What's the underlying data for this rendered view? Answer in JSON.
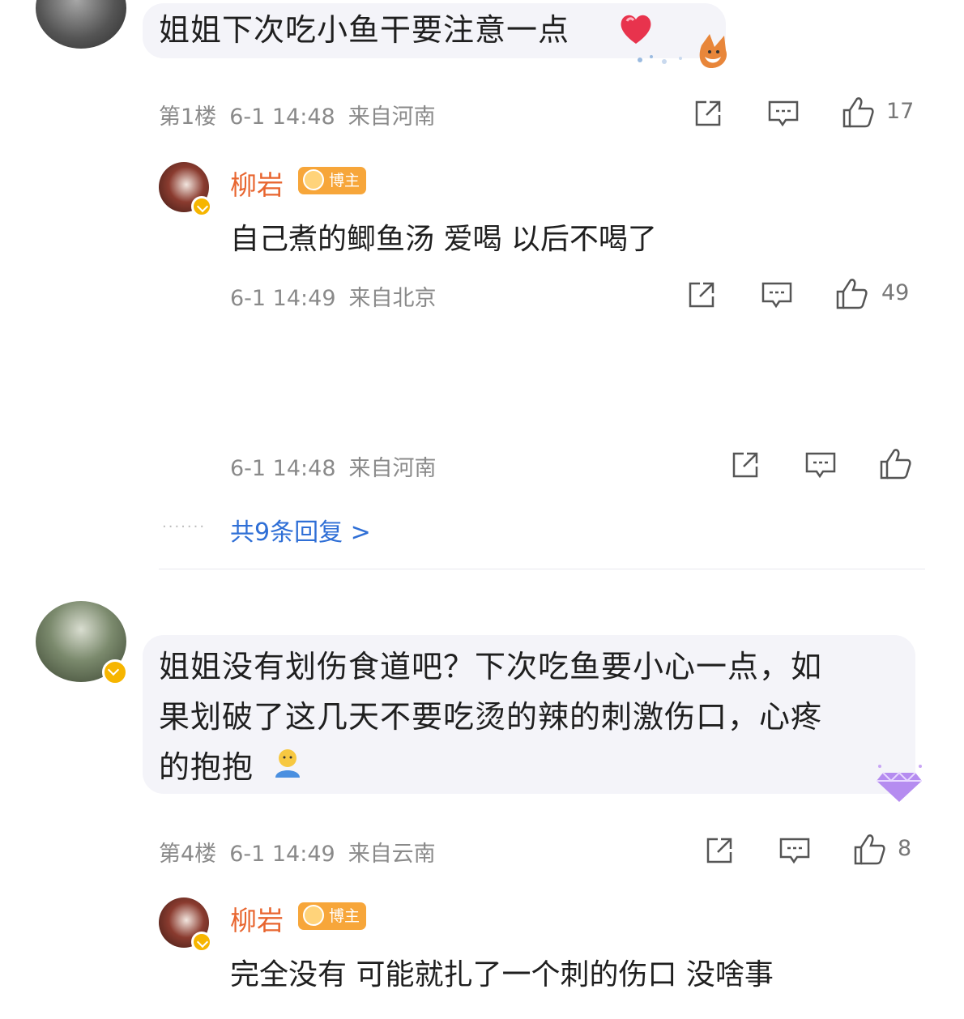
{
  "comments": [
    {
      "text": "姐姐下次吃小鱼干要注意一点",
      "floor": "第1楼",
      "time": "6-1 14:48",
      "location": "来自河南",
      "likes": "17",
      "replies": [
        {
          "author": "柳岩",
          "badge": "博主",
          "text": "自己煮的鲫鱼汤 爱喝 以后不喝了",
          "time": "6-1 14:49",
          "location": "来自北京",
          "likes": "49"
        }
      ],
      "extra_reply_meta": {
        "time": "6-1 14:48",
        "location": "来自河南"
      },
      "more_replies": "共9条回复 >"
    },
    {
      "text_lines": [
        "姐姐没有划伤食道吧？下次吃鱼要小心一点，如",
        "果划破了这几天不要吃烫的辣的刺激伤口，心疼",
        "的抱抱"
      ],
      "floor": "第4楼",
      "time": "6-1 14:49",
      "location": "来自云南",
      "likes": "8",
      "replies": [
        {
          "author": "柳岩",
          "badge": "博主",
          "text": "完全没有 可能就扎了一个刺的伤口 没啥事"
        }
      ]
    }
  ],
  "colors": {
    "author": "#e8652f",
    "link": "#2f6fd6",
    "meta": "#8a8a8a",
    "bubble": "#f4f4f9"
  }
}
